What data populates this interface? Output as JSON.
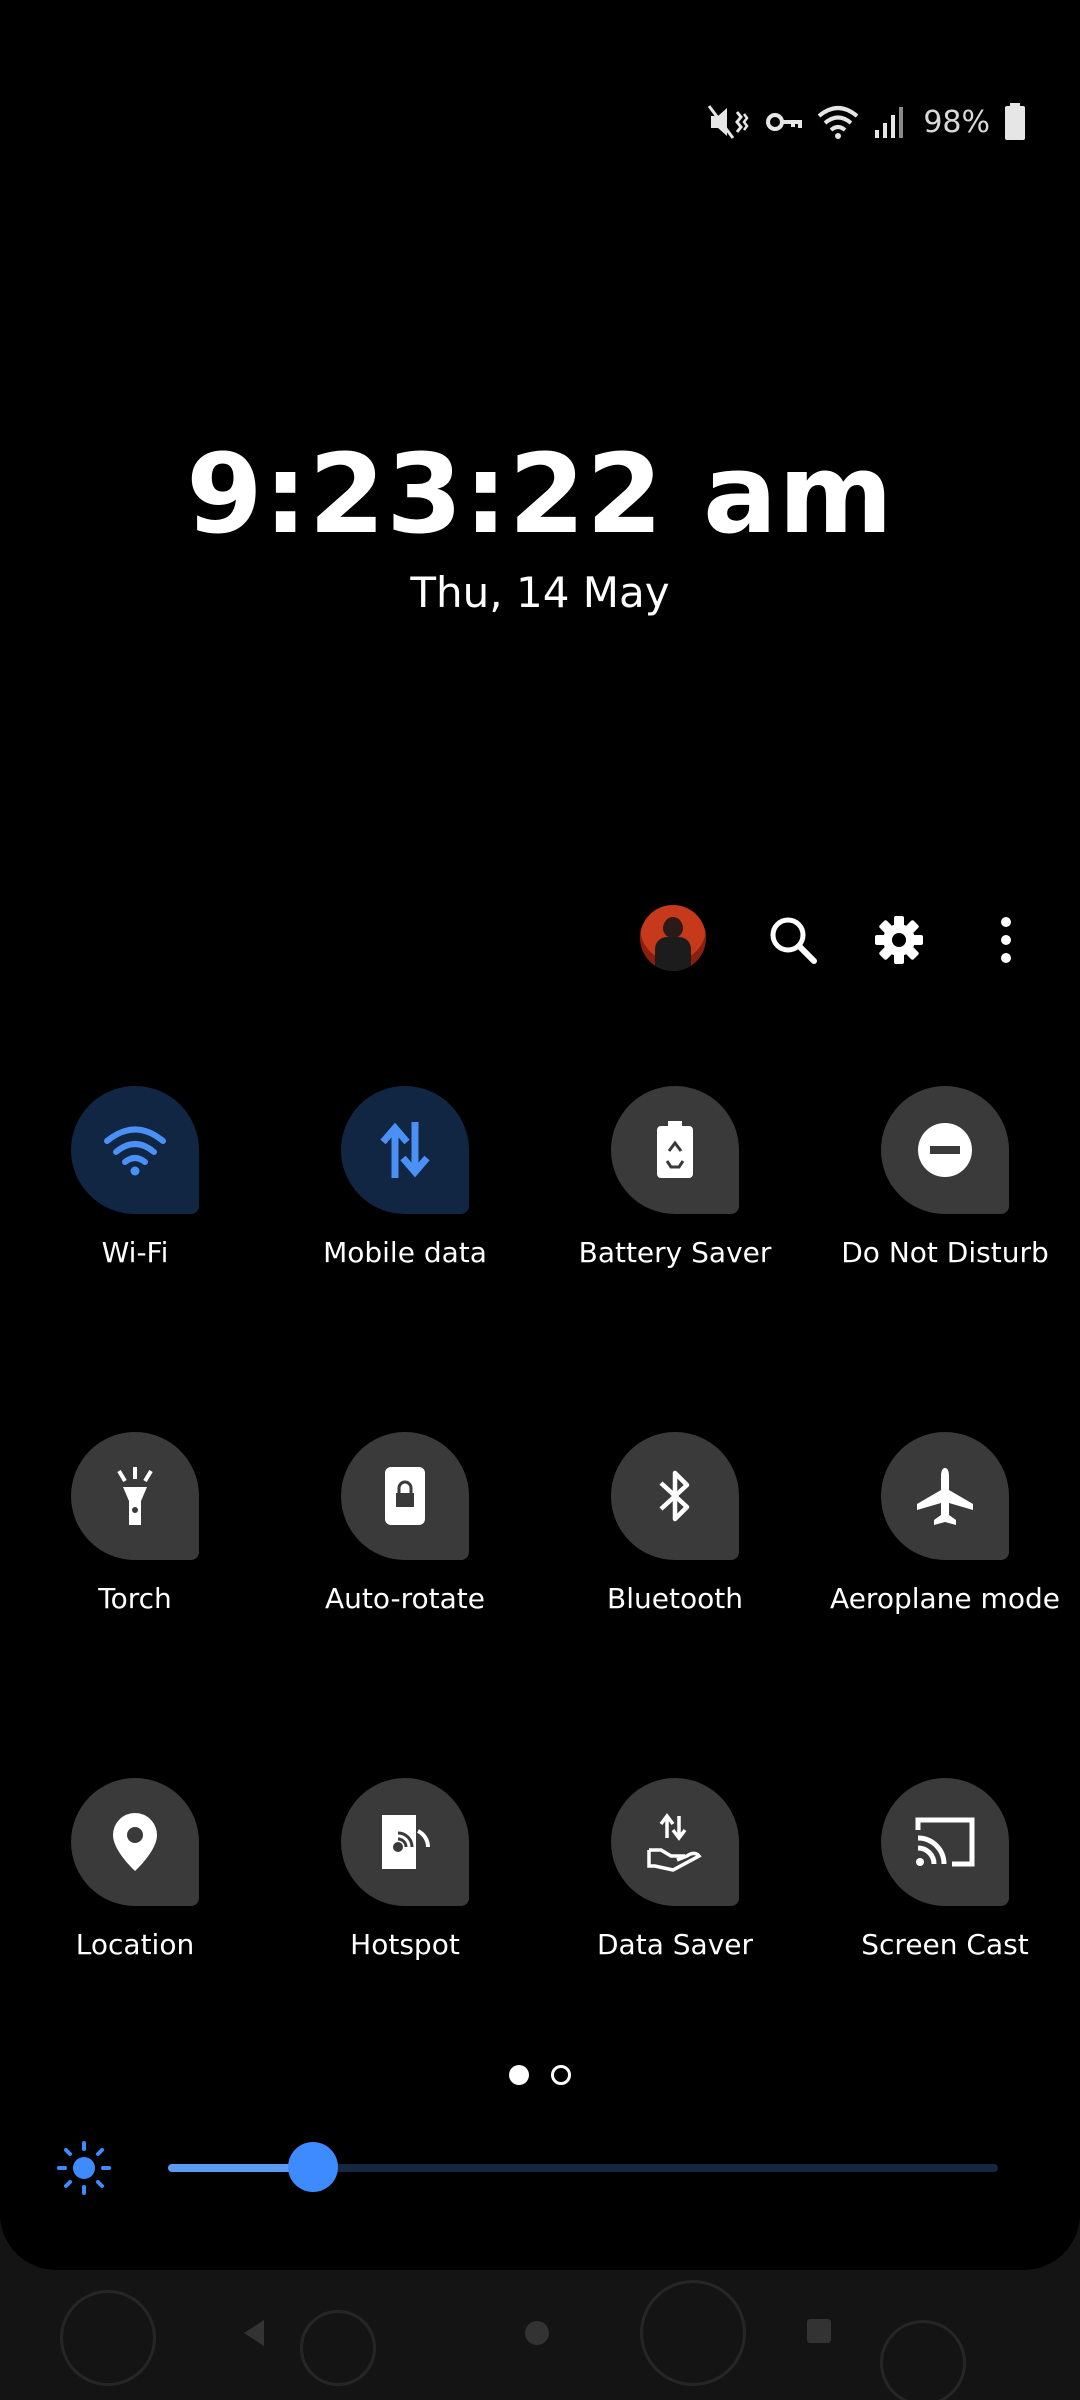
{
  "status_bar": {
    "icons": [
      "mute-vibrate-icon",
      "vpn-key-icon",
      "wifi-icon",
      "signal-icon",
      "battery-icon"
    ],
    "battery_percent": "98%"
  },
  "clock": {
    "time": "9:23:22 am",
    "date": "Thu, 14 May"
  },
  "header_actions": {
    "icons": [
      "avatar",
      "search-icon",
      "gear-icon",
      "more-vert-icon"
    ]
  },
  "tiles": [
    {
      "label": "Wi-Fi",
      "icon": "wifi-icon",
      "active": true
    },
    {
      "label": "Mobile data",
      "icon": "mobile-data-icon",
      "active": true
    },
    {
      "label": "Battery Saver",
      "icon": "battery-saver-icon",
      "active": false
    },
    {
      "label": "Do Not Disturb",
      "icon": "dnd-icon",
      "active": false
    },
    {
      "label": "Torch",
      "icon": "torch-icon",
      "active": false
    },
    {
      "label": "Auto-rotate",
      "icon": "rotate-lock-icon",
      "active": false
    },
    {
      "label": "Bluetooth",
      "icon": "bluetooth-icon",
      "active": false
    },
    {
      "label": "Aeroplane mode",
      "icon": "airplane-icon",
      "active": false
    },
    {
      "label": "Location",
      "icon": "location-icon",
      "active": false
    },
    {
      "label": "Hotspot",
      "icon": "hotspot-icon",
      "active": false
    },
    {
      "label": "Data Saver",
      "icon": "data-saver-icon",
      "active": false
    },
    {
      "label": "Screen Cast",
      "icon": "cast-icon",
      "active": false
    }
  ],
  "pages": {
    "current": 1,
    "total": 2
  },
  "brightness": {
    "level": 0.175
  },
  "colors": {
    "accent": "#3d8bff",
    "tile_active_bg": "#112642",
    "tile_inactive_bg": "#3a3a3a",
    "icon_active": "#4a90f5",
    "icon_inactive": "#ffffff"
  },
  "nav_bar": {
    "buttons": [
      "back-icon",
      "home-icon",
      "recents-icon"
    ]
  }
}
